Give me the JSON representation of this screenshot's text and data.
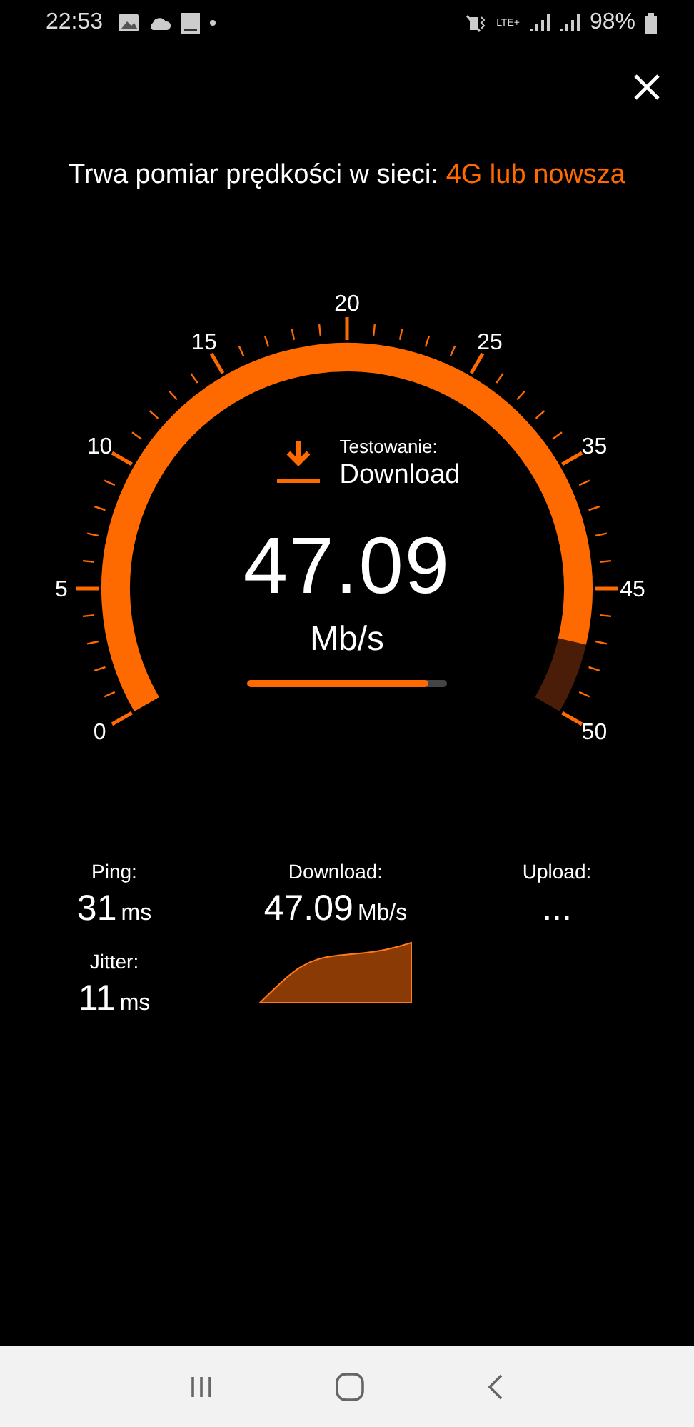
{
  "status_bar": {
    "time": "22:53",
    "network": "LTE+",
    "battery": "98%"
  },
  "title": {
    "label": "Trwa pomiar prędkości w sieci:",
    "network": "4G lub nowsza"
  },
  "gauge": {
    "scale": [
      "0",
      "5",
      "10",
      "15",
      "20",
      "25",
      "35",
      "45",
      "50"
    ],
    "phase_label": "Testowanie:",
    "phase": "Download",
    "value": "47.09",
    "unit": "Mb/s",
    "progress": {
      "level": 0.91
    }
  },
  "results": {
    "ping": {
      "label": "Ping:",
      "value": "31",
      "unit": "ms"
    },
    "jitter": {
      "label": "Jitter:",
      "value": "11",
      "unit": "ms"
    },
    "download": {
      "label": "Download:",
      "value": "47.09",
      "unit": "Mb/s"
    },
    "upload": {
      "label": "Upload:",
      "value": "..."
    }
  }
}
